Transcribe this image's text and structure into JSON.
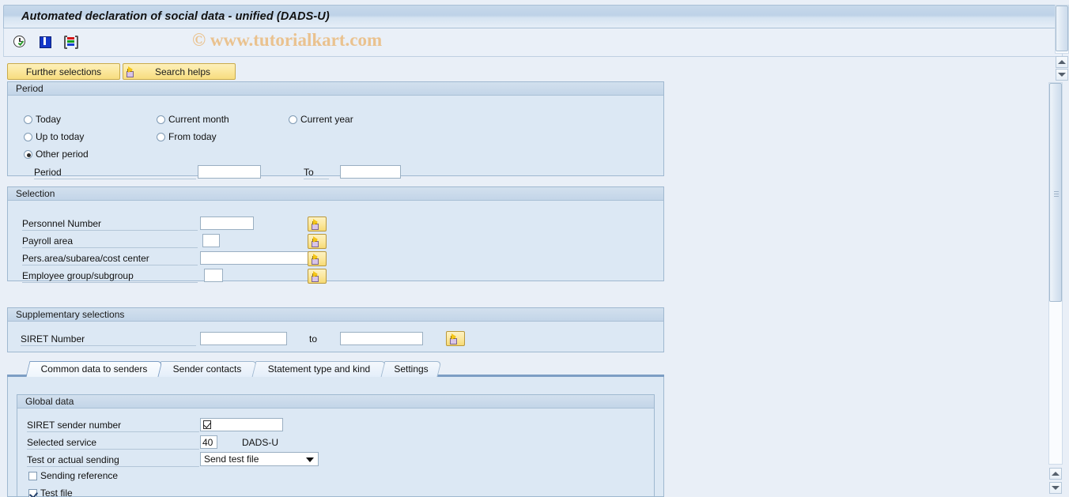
{
  "window": {
    "title": "Automated declaration of social data - unified (DADS-U)",
    "watermark": "© www.tutorialkart.com"
  },
  "toolbar": {
    "icons": [
      {
        "name": "execute-clock-icon",
        "title": "Execute"
      },
      {
        "name": "info-icon",
        "title": "Information"
      },
      {
        "name": "color-bars-icon",
        "title": "Layout"
      }
    ]
  },
  "action_buttons": {
    "further_selections": "Further selections",
    "search_helps": "Search helps"
  },
  "period_panel": {
    "title": "Period",
    "radios": [
      {
        "label": "Today",
        "selected": false
      },
      {
        "label": "Current month",
        "selected": false
      },
      {
        "label": "Current year",
        "selected": false
      },
      {
        "label": "Up to today",
        "selected": false
      },
      {
        "label": "From today",
        "selected": false
      },
      {
        "label": "Other period",
        "selected": true
      }
    ],
    "period_label": "Period",
    "period_value": "",
    "to_label": "To",
    "to_value": ""
  },
  "selection_panel": {
    "title": "Selection",
    "rows": [
      {
        "label": "Personnel Number",
        "value": "",
        "has_multi_button": true
      },
      {
        "label": "Payroll area",
        "value": "",
        "has_multi_button": true
      },
      {
        "label": "Pers.area/subarea/cost center",
        "value": "",
        "has_multi_button": true
      },
      {
        "label": "Employee group/subgroup",
        "value": "",
        "has_multi_button": true
      }
    ]
  },
  "supplementary_panel": {
    "title": "Supplementary selections",
    "siret_label": "SIRET Number",
    "siret_from": "",
    "to_label": "to",
    "siret_to": ""
  },
  "tabs": [
    {
      "label": "Common data to senders",
      "active": true
    },
    {
      "label": "Sender contacts",
      "active": false
    },
    {
      "label": "Statement type and kind",
      "active": false
    },
    {
      "label": "Settings",
      "active": false
    }
  ],
  "global_data": {
    "title": "Global data",
    "siret_sender_label": "SIRET sender number",
    "siret_sender_value": "",
    "selected_service_label": "Selected service",
    "selected_service_value": "40",
    "selected_service_text": "DADS-U",
    "test_or_actual_label": "Test or actual sending",
    "test_or_actual_value": "Send test file",
    "sending_reference_label": "Sending reference",
    "sending_reference_checked": false,
    "test_file_label": "Test file",
    "test_file_checked": true
  },
  "colors": {
    "title_bar": "#c6d8ea",
    "panel_bg": "#dce8f4",
    "button_yellow": "#fbe79c",
    "accent_blue": "#7d9ec4",
    "watermark": "#eac28f"
  }
}
